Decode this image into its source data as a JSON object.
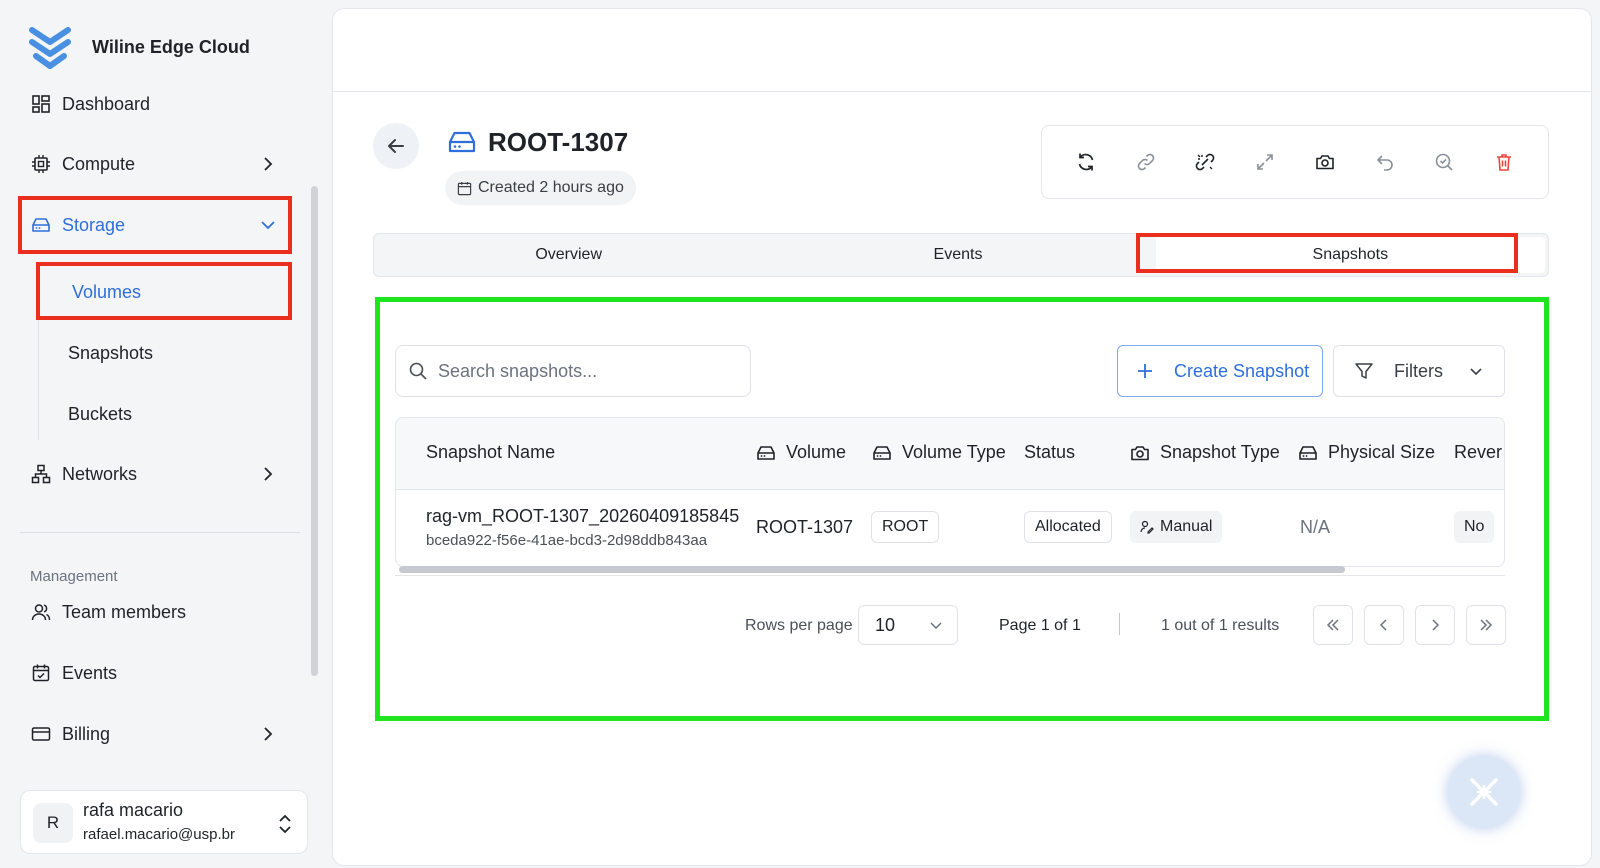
{
  "brand": {
    "name": "Wiline Edge Cloud",
    "logo_icon": "wiline-logo-icon"
  },
  "sidebar": {
    "items": [
      {
        "label": "Dashboard",
        "icon": "dashboard-icon"
      },
      {
        "label": "Compute",
        "icon": "cpu-icon"
      },
      {
        "label": "Storage",
        "icon": "storage-icon"
      },
      {
        "label": "Networks",
        "icon": "network-icon"
      }
    ],
    "storage_sub": [
      "Volumes",
      "Snapshots",
      "Buckets"
    ],
    "section_label": "Management",
    "management": [
      {
        "label": "Team members",
        "icon": "users-icon"
      },
      {
        "label": "Events",
        "icon": "calendar-icon"
      },
      {
        "label": "Billing",
        "icon": "card-icon"
      }
    ]
  },
  "user": {
    "initial": "R",
    "name": "rafa macario",
    "email": "rafael.macario@usp.br"
  },
  "header": {
    "title": "ROOT-1307",
    "created": "Created 2 hours ago",
    "toolbar_icons": [
      "refresh-icon",
      "link-icon",
      "unlink-icon",
      "expand-icon",
      "camera-icon",
      "undo-icon",
      "search-check-icon",
      "trash-icon"
    ]
  },
  "tabs": [
    "Overview",
    "Events",
    "Snapshots"
  ],
  "snapshots": {
    "search_placeholder": "Search snapshots...",
    "create_label": "Create Snapshot",
    "filters_label": "Filters",
    "columns": [
      "Snapshot Name",
      "Volume",
      "Volume Type",
      "Status",
      "Snapshot Type",
      "Physical Size",
      "Rever"
    ],
    "rows": [
      {
        "name": "rag-vm_ROOT-1307_20260409185845",
        "id": "bceda922-f56e-41ae-bcd3-2d98ddb843aa",
        "volume": "ROOT-1307",
        "volume_type": "ROOT",
        "status": "Allocated",
        "snapshot_type": "Manual",
        "physical_size": "N/A",
        "revertable": "No"
      }
    ],
    "pagination": {
      "rows_per_page_label": "Rows per page",
      "rows_per_page": "10",
      "page_label": "Page 1 of 1",
      "results_label": "1 out of 1 results"
    }
  },
  "colors": {
    "accent": "#2f6fdb",
    "highlight_red": "#ea2f1e",
    "highlight_green": "#1ee51e",
    "danger": "#e5483b"
  }
}
